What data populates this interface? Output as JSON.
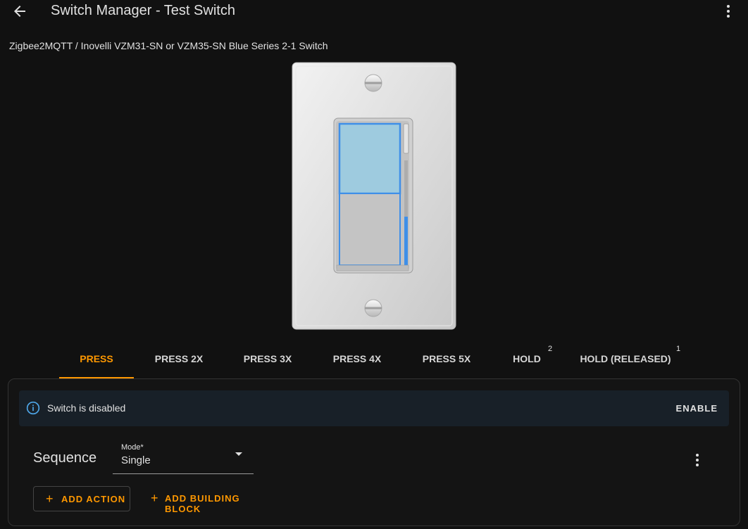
{
  "header": {
    "title": "Switch Manager - Test Switch"
  },
  "device": {
    "name": "Zigbee2MQTT / Inovelli VZM31-SN or VZM35-SN Blue Series 2-1 Switch"
  },
  "tabs": [
    {
      "label": "PRESS",
      "active": true
    },
    {
      "label": "PRESS 2X"
    },
    {
      "label": "PRESS 3X"
    },
    {
      "label": "PRESS 4X"
    },
    {
      "label": "PRESS 5X"
    },
    {
      "label": "HOLD",
      "badge": "2"
    },
    {
      "label": "HOLD (RELEASED)",
      "badge": "1"
    }
  ],
  "alert": {
    "message": "Switch is disabled",
    "action_label": "ENABLE"
  },
  "sequence": {
    "title": "Sequence",
    "mode_label": "Mode*",
    "mode_value": "Single",
    "add_action_label": "ADD ACTION",
    "add_block_label": "ADD BUILDING BLOCK"
  },
  "colors": {
    "accent": "#ff9800",
    "background": "#111111",
    "alert_bg": "#182028",
    "switch_highlight": "#4a90e2"
  }
}
